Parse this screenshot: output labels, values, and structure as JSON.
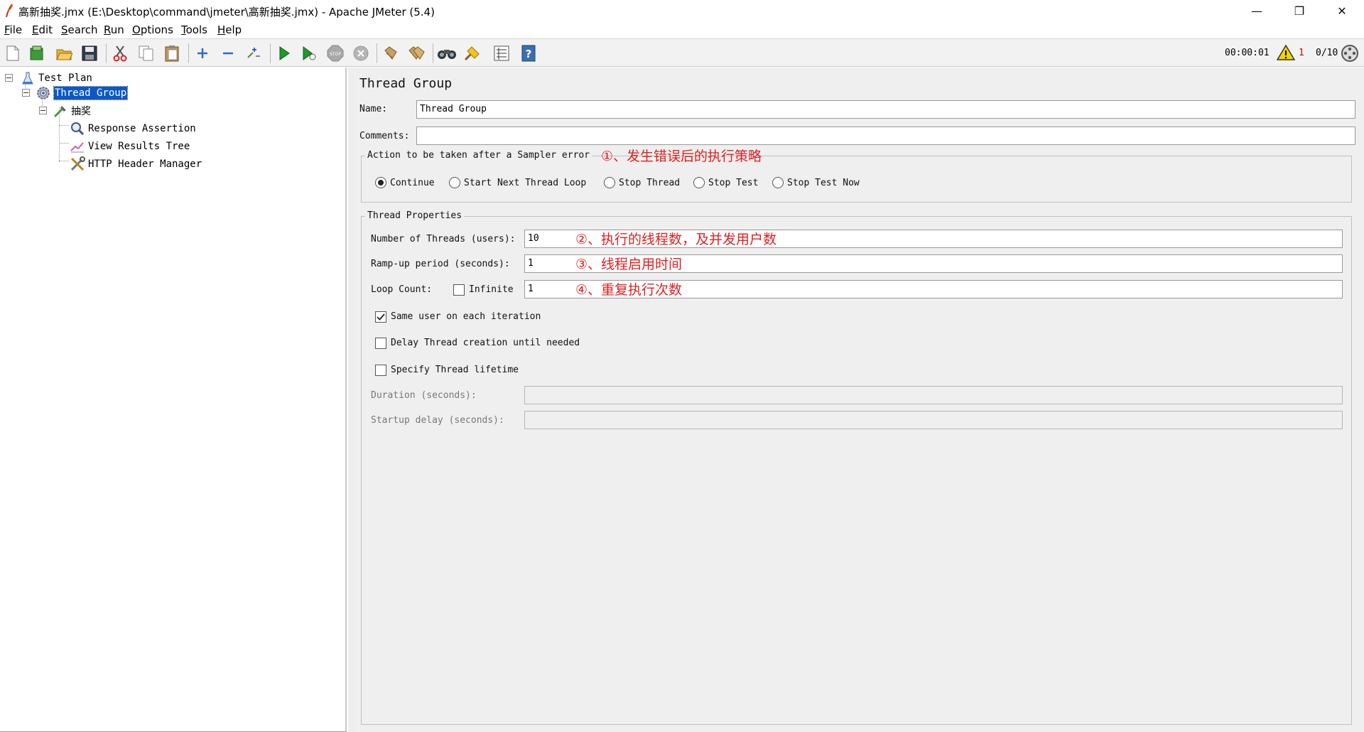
{
  "window": {
    "title": "高新抽奖.jmx (E:\\Desktop\\command\\jmeter\\高新抽奖.jmx) - Apache JMeter (5.4)",
    "minimize": "—",
    "restore": "❐",
    "close": "✕"
  },
  "menu": [
    "File",
    "Edit",
    "Search",
    "Run",
    "Options",
    "Tools",
    "Help"
  ],
  "toolbar": {
    "icons": [
      "new-icon",
      "templates-icon",
      "open-icon",
      "save-icon",
      "cut-icon",
      "copy-icon",
      "paste-icon",
      "expand-icon",
      "collapse-icon",
      "toggle-icon",
      "start-icon",
      "start-no-timers-icon",
      "stop-icon",
      "shutdown-icon",
      "clear-icon",
      "clear-all-icon",
      "search-icon",
      "reset-search-icon",
      "function-helper-icon",
      "help-icon"
    ],
    "timer": "00:00:01",
    "warning_count": "1",
    "threads": "0/10"
  },
  "tree": {
    "test_plan": "Test Plan",
    "thread_group": "Thread Group",
    "controller": "抽奖",
    "response_assertion": "Response Assertion",
    "view_results_tree": "View Results Tree",
    "http_header_manager": "HTTP Header Manager"
  },
  "panel": {
    "heading": "Thread Group",
    "name_label": "Name:",
    "name_value": "Thread Group",
    "comments_label": "Comments:",
    "comments_value": "",
    "action_group_title": "Action to be taken after a Sampler error",
    "action_annotation": "①、发生错误后的执行策略",
    "actions": [
      {
        "label": "Continue",
        "checked": true
      },
      {
        "label": "Start Next Thread Loop",
        "checked": false
      },
      {
        "label": "Stop Thread",
        "checked": false
      },
      {
        "label": "Stop Test",
        "checked": false
      },
      {
        "label": "Stop Test Now",
        "checked": false
      }
    ],
    "props_group_title": "Thread Properties",
    "threads_label": "Number of Threads (users):",
    "threads_value": "10",
    "threads_annotation": "②、执行的线程数，及并发用户数",
    "rampup_label": "Ramp-up period (seconds):",
    "rampup_value": "1",
    "rampup_annotation": "③、线程启用时间",
    "loop_label": "Loop Count:",
    "infinite_label": "Infinite",
    "infinite_checked": false,
    "loop_value": "1",
    "loop_annotation": "④、重复执行次数",
    "same_user_label": "Same user on each iteration",
    "same_user_checked": true,
    "delay_label": "Delay Thread creation until needed",
    "delay_checked": false,
    "lifetime_label": "Specify Thread lifetime",
    "lifetime_checked": false,
    "duration_label": "Duration (seconds):",
    "duration_value": "",
    "startup_label": "Startup delay (seconds):",
    "startup_value": ""
  }
}
